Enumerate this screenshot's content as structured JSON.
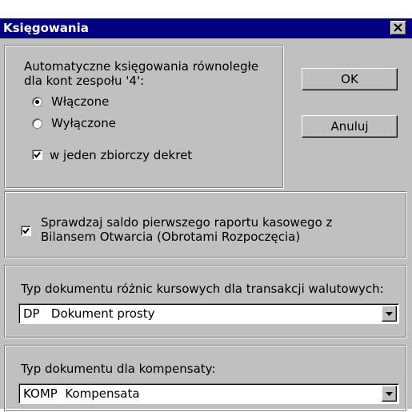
{
  "window": {
    "title": "Księgowania"
  },
  "auto_postings": {
    "label_line1": "Automatyczne księgowania równoległe",
    "label_line2": "dla kont zespołu '4':",
    "options": [
      {
        "label": "Włączone",
        "selected": true
      },
      {
        "label": "Wyłączone",
        "selected": false
      }
    ],
    "single_decree": {
      "label": "w jeden zbiorczy dekret",
      "checked": true
    }
  },
  "buttons": {
    "ok": "OK",
    "cancel": "Anuluj"
  },
  "cash_report_check": {
    "line1": "Sprawdzaj saldo pierwszego raportu kasowego z",
    "line2": "Bilansem Otwarcia (Obrotami Rozpoczęcia)",
    "checked": true
  },
  "fx_document": {
    "label": "Typ dokumentu różnic kursowych dla transakcji walutowych:",
    "value": "DP   Dokument prosty"
  },
  "compensation_document": {
    "label": "Typ dokumentu dla kompensaty:",
    "value": "KOMP  Kompensata"
  },
  "icons": {
    "close": "close-icon",
    "radio_dot": "radio-dot-icon",
    "checkmark": "checkmark-icon",
    "dropdown": "dropdown-arrow-icon"
  }
}
